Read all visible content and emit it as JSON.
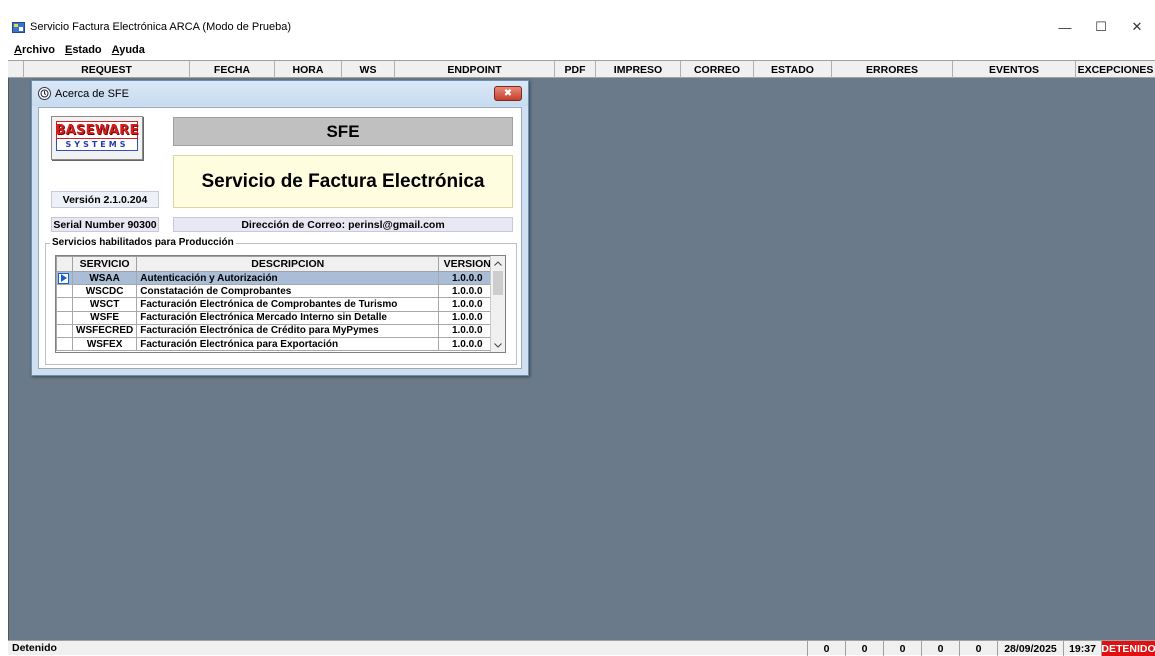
{
  "window": {
    "title": "Servicio Factura Electrónica ARCA (Modo de Prueba)",
    "minimize_glyph": "—",
    "maximize_glyph": "☐",
    "close_glyph": "✕"
  },
  "menu": {
    "items": [
      {
        "ul": "A",
        "rest": "rchivo"
      },
      {
        "ul": "E",
        "rest": "stado"
      },
      {
        "ul": "A",
        "rest": "yuda"
      }
    ]
  },
  "grid": {
    "columns": [
      "REQUEST",
      "FECHA",
      "HORA",
      "WS",
      "ENDPOINT",
      "PDF",
      "IMPRESO",
      "CORREO",
      "ESTADO",
      "ERRORES",
      "EVENTOS",
      "EXCEPCIONES"
    ]
  },
  "statusbar": {
    "status": "Detenido",
    "counters": [
      "0",
      "0",
      "0",
      "0",
      "0"
    ],
    "date": "28/09/2025",
    "time": "19:37",
    "state": "DETENIDO",
    "state_color": "#e01010"
  },
  "dialog": {
    "title": "Acerca de SFE",
    "close_glyph": "✖",
    "logo_top": "BASEWARE",
    "logo_bottom": "SYSTEMS",
    "product_short": "SFE",
    "product_full": "Servicio de Factura Electrónica",
    "version": "Versión 2.1.0.204",
    "serial": "Serial Number 90300",
    "email": "Dirección de Correo: perinsl@gmail.com",
    "group_label": "Servicios habilitados para Producción",
    "table": {
      "headers": [
        "SERVICIO",
        "DESCRIPCION",
        "VERSION"
      ],
      "rows": [
        {
          "servicio": "WSAA",
          "descripcion": "Autenticación y Autorización",
          "version": "1.0.0.0",
          "selected": true
        },
        {
          "servicio": "WSCDC",
          "descripcion": "Constatación de Comprobantes",
          "version": "1.0.0.0"
        },
        {
          "servicio": "WSCT",
          "descripcion": "Facturación Electrónica de Comprobantes de Turismo",
          "version": "1.0.0.0"
        },
        {
          "servicio": "WSFE",
          "descripcion": "Facturación Electrónica Mercado Interno sin Detalle",
          "version": "1.0.0.0"
        },
        {
          "servicio": "WSFECRED",
          "descripcion": "Facturación Electrónica de Crédito para MyPymes",
          "version": "1.0.0.0"
        },
        {
          "servicio": "WSFEX",
          "descripcion": "Facturación Electrónica para Exportación",
          "version": "1.0.0.0"
        }
      ]
    }
  }
}
